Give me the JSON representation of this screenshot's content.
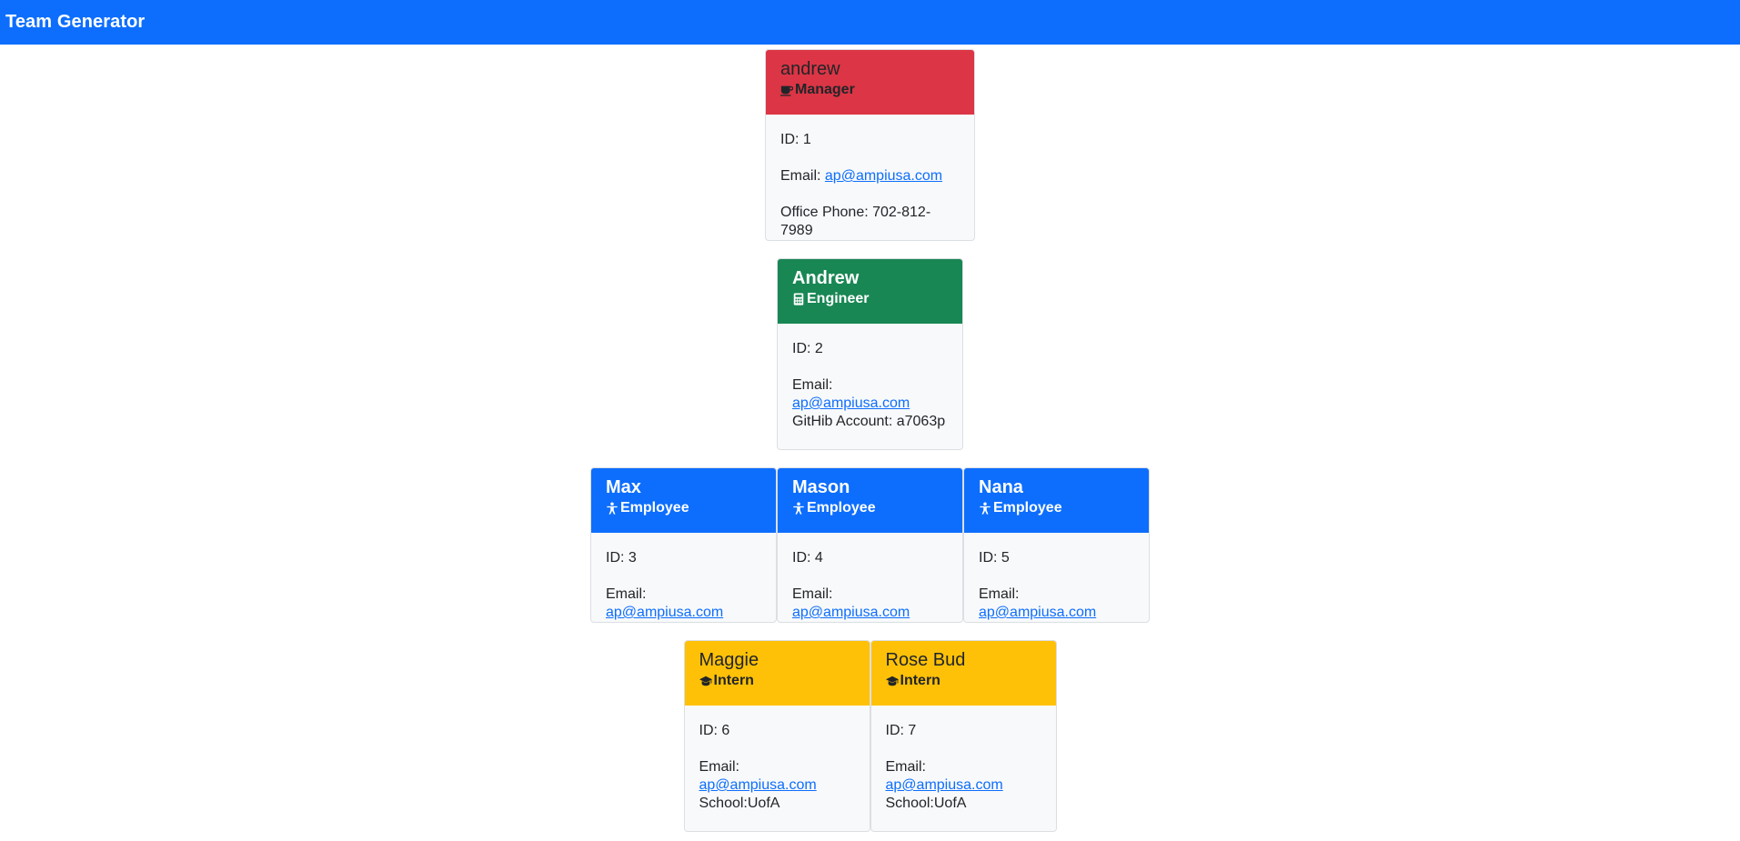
{
  "navbar": {
    "brand": "Team Generator"
  },
  "colors": {
    "manager": "#dc3545",
    "engineer": "#198754",
    "employee": "#0d6efd",
    "intern": "#ffc107",
    "link": "#0d6efd"
  },
  "labels": {
    "id": "ID: ",
    "email": "Email: ",
    "office_phone": "Office Phone: ",
    "github": "GitHib Account: ",
    "school": "School:"
  },
  "manager": {
    "name": "andrew",
    "role": "Manager",
    "icon": "coffee-cup-icon",
    "id": "1",
    "email": "ap@ampiusa.com",
    "office_phone": "702-812-7989"
  },
  "engineer": {
    "name": "Andrew",
    "role": "Engineer",
    "icon": "calculator-icon",
    "id": "2",
    "email": "ap@ampiusa.com",
    "github": "a7063p"
  },
  "employees": [
    {
      "name": "Max",
      "role": "Employee",
      "icon": "person-icon",
      "id": "3",
      "email": "ap@ampiusa.com"
    },
    {
      "name": "Mason",
      "role": "Employee",
      "icon": "person-icon",
      "id": "4",
      "email": "ap@ampiusa.com"
    },
    {
      "name": "Nana",
      "role": "Employee",
      "icon": "person-icon",
      "id": "5",
      "email": "ap@ampiusa.com"
    }
  ],
  "interns": [
    {
      "name": "Maggie",
      "role": "Intern",
      "icon": "graduation-cap-icon",
      "id": "6",
      "email": "ap@ampiusa.com",
      "school": "UofA"
    },
    {
      "name": "Rose Bud",
      "role": "Intern",
      "icon": "graduation-cap-icon",
      "id": "7",
      "email": "ap@ampiusa.com",
      "school": "UofA"
    }
  ]
}
